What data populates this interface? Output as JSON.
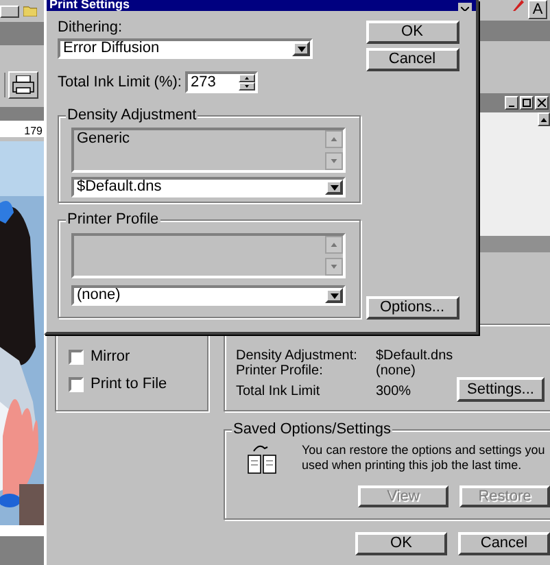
{
  "left_toolbar": {
    "ruler_label": "179"
  },
  "right_toolbar": {
    "button_letter": "A"
  },
  "background_dialog": {
    "checkboxes": [
      {
        "label": "Mirror",
        "checked": false
      },
      {
        "label": "Print to File",
        "checked": false
      }
    ],
    "summary": [
      {
        "label": "Density Adjustment:",
        "value": "$Default.dns"
      },
      {
        "label": "Printer Profile:",
        "value": "(none)"
      },
      {
        "label": "Total Ink Limit",
        "value": "300%"
      }
    ],
    "settings_button": "Settings...",
    "saved": {
      "title": "Saved Options/Settings",
      "text": "You can restore the options and settings you used when printing this job the last time.",
      "buttons": [
        {
          "label": "View",
          "disabled": true
        },
        {
          "label": "Restore",
          "disabled": true
        }
      ]
    },
    "buttons": [
      "OK",
      "Cancel"
    ]
  },
  "dialog": {
    "title": "Print Settings",
    "dithering": {
      "label": "Dithering:",
      "value": "Error Diffusion"
    },
    "ink_limit": {
      "label": "Total Ink Limit (%):",
      "value": "273"
    },
    "density": {
      "title": "Density Adjustment",
      "list_items": [
        "Generic"
      ],
      "value": "$Default.dns"
    },
    "profile": {
      "title": "Printer Profile",
      "value": "(none)"
    },
    "buttons": [
      "OK",
      "Cancel"
    ],
    "options_button": "Options..."
  }
}
